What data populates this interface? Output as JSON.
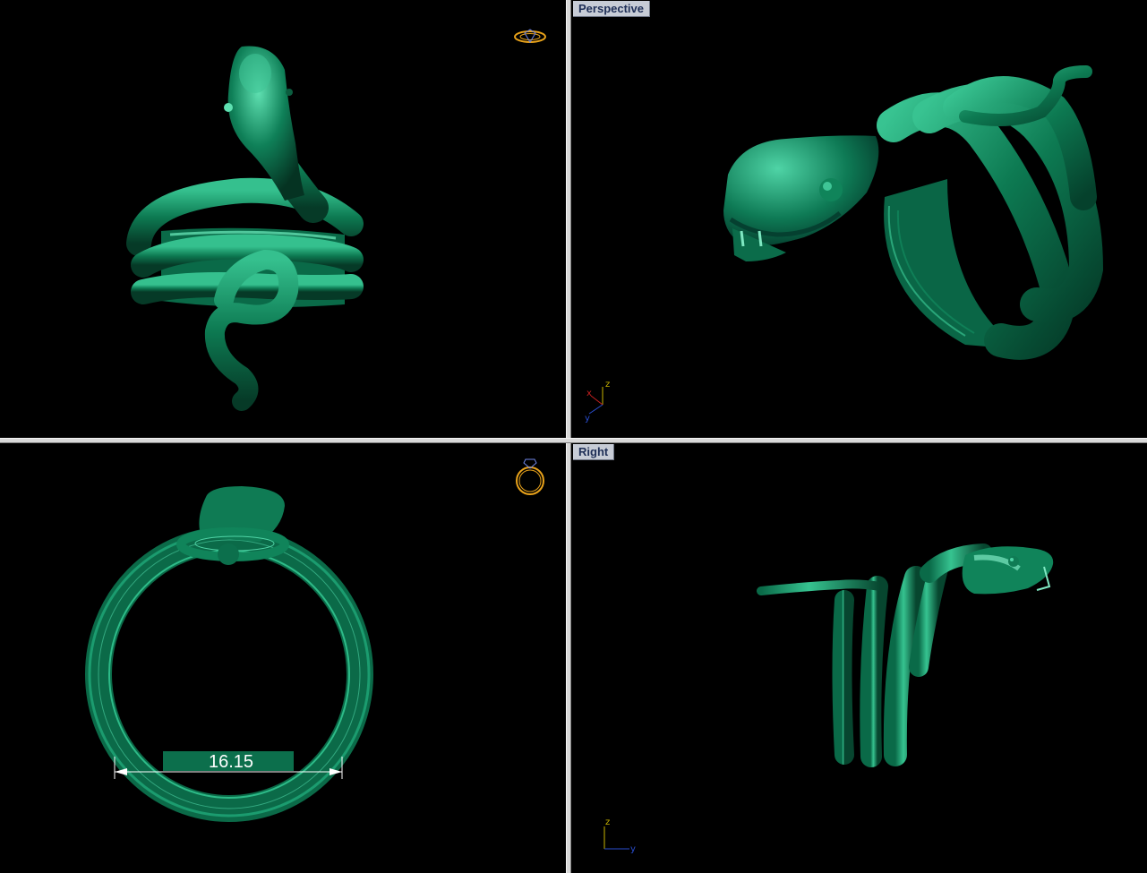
{
  "viewports": {
    "top_left": {
      "label": ""
    },
    "perspective": {
      "label": "Perspective"
    },
    "bottom_left": {
      "label": ""
    },
    "right": {
      "label": "Right"
    }
  },
  "axes": {
    "perspective": {
      "x": "x",
      "y": "y",
      "z": "z"
    },
    "right": {
      "y": "y",
      "z": "z"
    }
  },
  "dimension": {
    "value": "16.15"
  },
  "colors": {
    "viewport_bg": "#000000",
    "model_green": "#0e7a55",
    "model_highlight": "#4fd4a6",
    "label_bg": "#c7ccd6",
    "label_text": "#1f2f57",
    "axis_x": "#c82020",
    "axis_y": "#2a4ed0",
    "axis_z": "#c8b400",
    "gizmo": "#e8a21a"
  },
  "icons": [
    "ring-gizmo-icon",
    "ring-front-gizmo-icon",
    "axis-triad-icon"
  ]
}
